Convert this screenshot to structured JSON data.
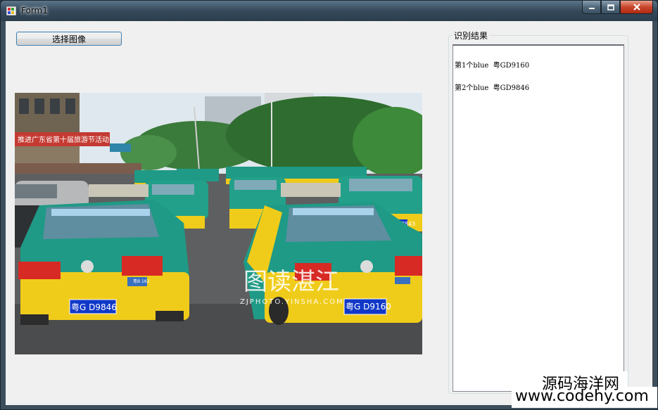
{
  "window": {
    "title": "Form1",
    "caption_buttons": [
      "minimize",
      "maximize",
      "close"
    ]
  },
  "toolbar": {
    "choose_image_label": "选择图像"
  },
  "results": {
    "group_label": "识别结果",
    "items": [
      "第1个blue  粤GD9160",
      "第2个blue  粤GD9846"
    ]
  },
  "photo": {
    "building_banner": "推进广东省第十届旅游节活动",
    "watermark_text": "图读湛江",
    "watermark_url": "ZJPHOTO.YINSHA.COM",
    "plate_left": "粤G D9846",
    "plate_right": "粤G D9160",
    "plate_back": "粤G D8843",
    "plate_far_left": "粤B 162"
  },
  "site_watermark": {
    "line1": "源码海洋网",
    "line2": "www.codehy.com"
  },
  "colors": {
    "taxi_green": "#1f9a86",
    "taxi_yellow": "#f0cc1a",
    "plate_blue": "#1038c8",
    "client_bg": "#f0f0f0"
  }
}
